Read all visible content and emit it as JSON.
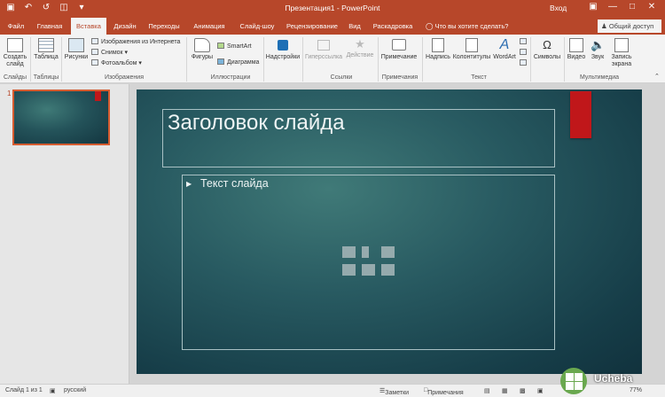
{
  "titlebar": {
    "title": "Презентация1 - PowerPoint",
    "signin": "Вход",
    "qat": [
      "save-icon",
      "undo-icon",
      "redo-icon",
      "presenter-icon",
      "customize-icon"
    ]
  },
  "tabs": [
    "Файл",
    "Главная",
    "Вставка",
    "Дизайн",
    "Переходы",
    "Анимация",
    "Слайд-шоу",
    "Рецензирование",
    "Вид",
    "Раскадровка"
  ],
  "active_tab": "Вставка",
  "tellme": "Что вы хотите сделать?",
  "share": "Общий доступ",
  "ribbon": {
    "new_slide": "Создать слайд",
    "table": "Таблица",
    "pictures": "Рисунки",
    "online_pictures": "Изображения из Интернета",
    "screenshot": "Снимок",
    "photo_album": "Фотоальбом",
    "shapes": "Фигуры",
    "smartart": "SmartArt",
    "chart": "Диаграмма",
    "addins": "Надстройки",
    "hyperlink": "Гиперссылка",
    "action": "Действие",
    "comment": "Примечание",
    "textbox": "Надпись",
    "header_footer": "Колонтитулы",
    "wordart": "WordArt",
    "symbols": "Символы",
    "video": "Видео",
    "audio": "Звук",
    "screen_recording": "Запись экрана",
    "groups": {
      "slides": "Слайды",
      "tables": "Таблицы",
      "images": "Изображения",
      "illustrations": "Иллюстрации",
      "links": "Ссылки",
      "comments": "Примечания",
      "text": "Текст",
      "media": "Мультимедиа"
    }
  },
  "slide": {
    "title": "Заголовок слайда",
    "body": "Текст слайда",
    "number": "1"
  },
  "status": {
    "slide_of": "Слайд 1 из 1",
    "language": "русский",
    "notes": "Заметки",
    "comments": "Примечания",
    "zoom": "77%"
  },
  "watermark": "Ucheba"
}
